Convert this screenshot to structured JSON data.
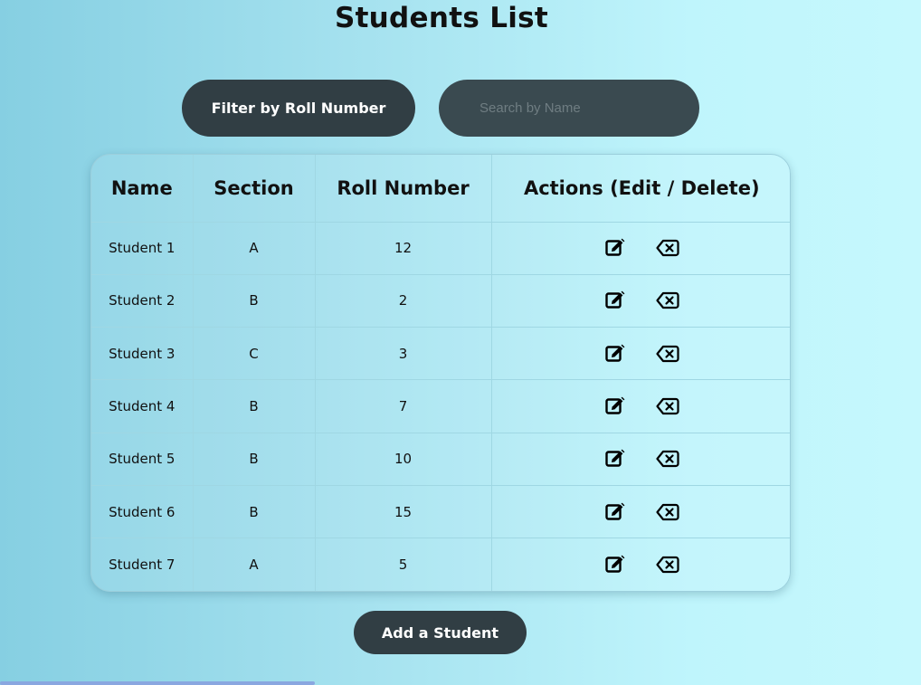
{
  "page": {
    "title": "Students List"
  },
  "controls": {
    "filter_label": "Filter by Roll Number",
    "search_placeholder": "Search by Name",
    "search_value": "",
    "add_label": "Add a Student"
  },
  "table": {
    "headers": [
      "Name",
      "Section",
      "Roll Number",
      "Actions (Edit / Delete)"
    ],
    "rows": [
      {
        "name": "Student 1",
        "section": "A",
        "roll": "12"
      },
      {
        "name": "Student 2",
        "section": "B",
        "roll": "2"
      },
      {
        "name": "Student 3",
        "section": "C",
        "roll": "3"
      },
      {
        "name": "Student 4",
        "section": "B",
        "roll": "7"
      },
      {
        "name": "Student 5",
        "section": "B",
        "roll": "10"
      },
      {
        "name": "Student 6",
        "section": "B",
        "roll": "15"
      },
      {
        "name": "Student 7",
        "section": "A",
        "roll": "5"
      }
    ],
    "row_icons": {
      "edit": "edit-icon",
      "delete": "backspace-delete-icon"
    }
  },
  "colors": {
    "button_bg": "#313e44",
    "input_bg": "#3a4a50",
    "background_left": "#86cfe2",
    "background_right": "#c6f8fd"
  }
}
